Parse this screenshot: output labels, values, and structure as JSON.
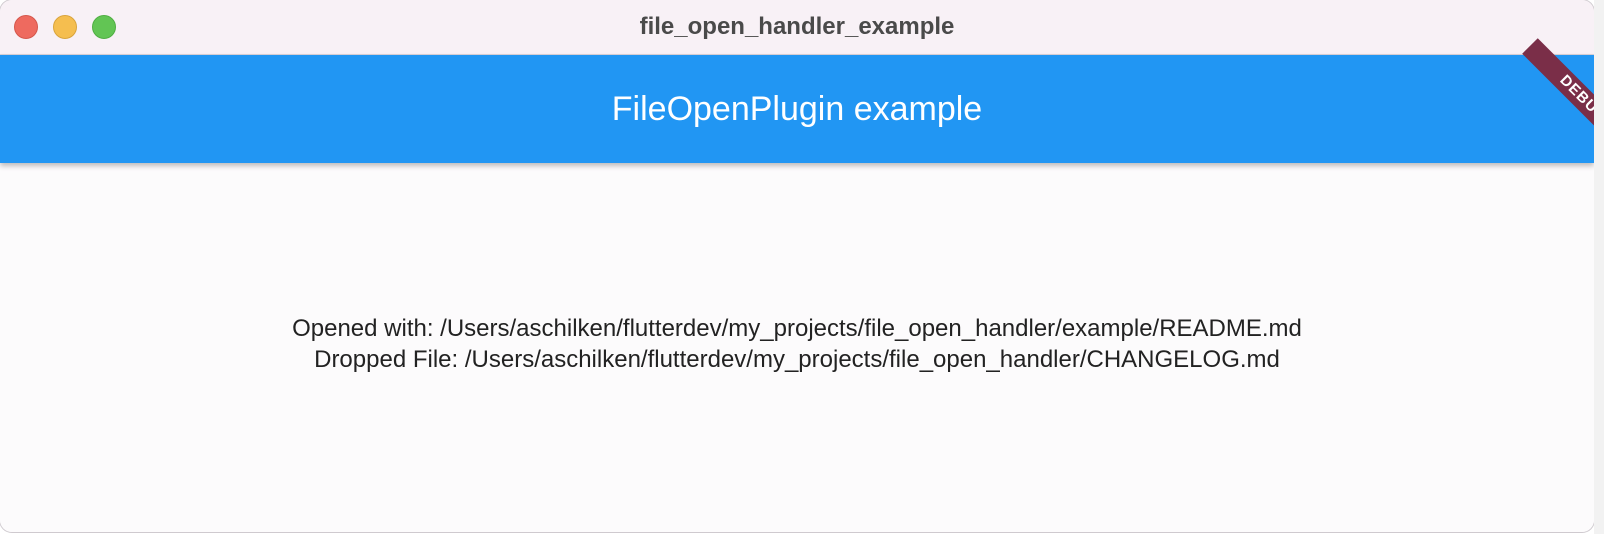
{
  "window": {
    "title": "file_open_handler_example"
  },
  "appbar": {
    "title": "FileOpenPlugin example",
    "debug_label": "DEBUG"
  },
  "content": {
    "opened_with": "Opened with: /Users/aschilken/flutterdev/my_projects/file_open_handler/example/README.md",
    "dropped_file": "Dropped File: /Users/aschilken/flutterdev/my_projects/file_open_handler/CHANGELOG.md"
  },
  "colors": {
    "appbar": "#2196f3",
    "debug_banner": "#7a2e48",
    "close": "#ee6a5f",
    "minimize": "#f5be4f",
    "zoom": "#62c554"
  }
}
